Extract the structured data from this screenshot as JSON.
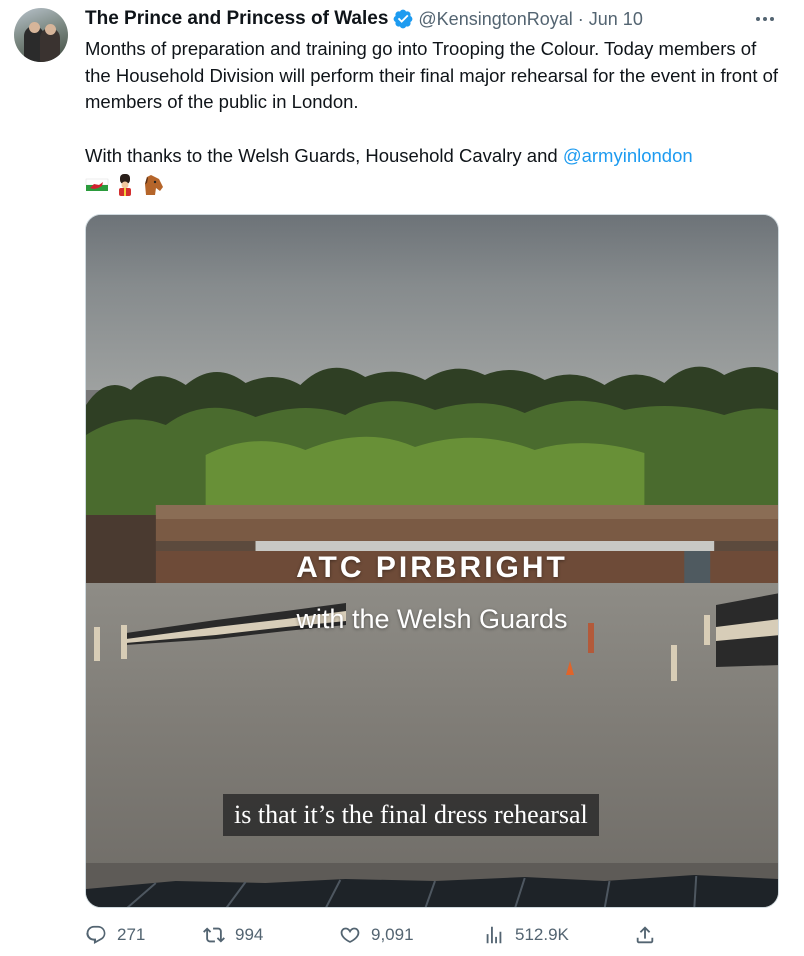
{
  "tweet": {
    "author": {
      "display_name": "The Prince and Princess of Wales",
      "handle": "@KensingtonRoyal",
      "separator": "·",
      "date": "Jun 10",
      "verified": true
    },
    "text": {
      "paragraph1": "Months of preparation and training go into Trooping the Colour. Today members of the Household Division will perform their final major rehearsal for the event in front of members of the public in London.",
      "paragraph2_prefix": "With thanks to the Welsh Guards, Household Cavalry and ",
      "mention": "@armyinlondon"
    },
    "emojis": [
      "wales-flag-icon",
      "guard-icon",
      "horse-face-icon"
    ],
    "media": {
      "overlay_title": "ATC PIRBRIGHT",
      "overlay_subtitle": "with the Welsh Guards",
      "subtitle_caption": "is that it’s the final dress rehearsal"
    },
    "actions": {
      "replies": "271",
      "retweets": "994",
      "likes": "9,091",
      "views": "512.9K"
    }
  },
  "colors": {
    "link": "#1d9bf0",
    "secondary_text": "#536471",
    "primary_text": "#0f1419",
    "verified_badge": "#1d9bf0"
  }
}
